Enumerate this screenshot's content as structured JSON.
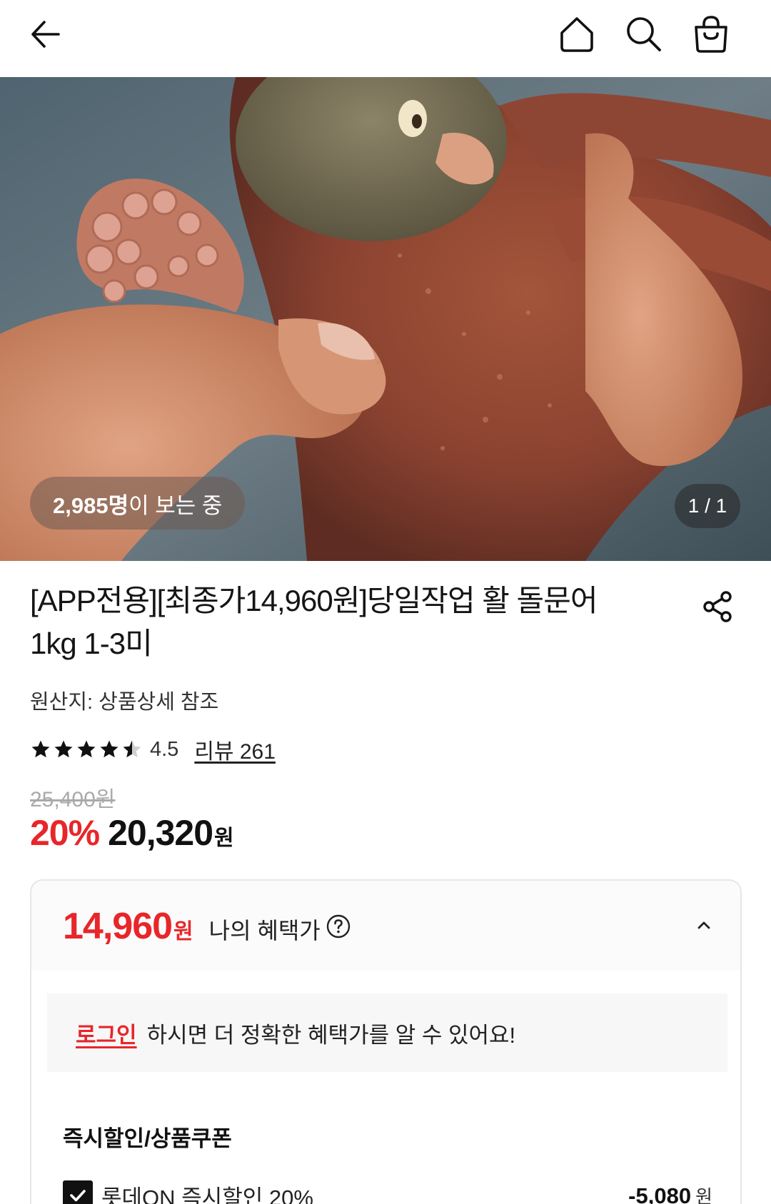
{
  "header": {
    "back_icon": "arrow-left-icon",
    "home_icon": "home-icon",
    "search_icon": "search-icon",
    "cart_icon": "shopping-bag-icon"
  },
  "gallery": {
    "viewers_count": "2,985명",
    "viewers_suffix": "이 보는 중",
    "page_counter": "1 / 1"
  },
  "product": {
    "title": "[APP전용][최종가14,960원]당일작업 활 돌문어 1kg 1-3미",
    "share_icon": "share-icon",
    "origin": "원산지: 상품상세 참조",
    "rating": "4.5",
    "rating_value": 4.5,
    "review_link": "리뷰 261",
    "original_price": "25,400원",
    "discount_rate": "20%",
    "sale_price": "20,320",
    "sale_price_unit": "원"
  },
  "benefit": {
    "price": "14,960",
    "price_unit": "원",
    "label": "나의 혜택가",
    "help_icon": "question-circle-icon",
    "collapse_icon": "chevron-up-icon",
    "login_link": "로그인",
    "login_message": "하시면 더 정확한 혜택가를 알 수 있어요!",
    "section_title": "즉시할인/상품쿠폰",
    "items": [
      {
        "label": "롯데ON 즉시할인 20%",
        "amount": "-5,080",
        "unit": "원",
        "checked": true
      }
    ]
  },
  "colors": {
    "accent_red": "#e8262a",
    "text_dark": "#111111",
    "strike_gray": "#aaaaaa"
  }
}
